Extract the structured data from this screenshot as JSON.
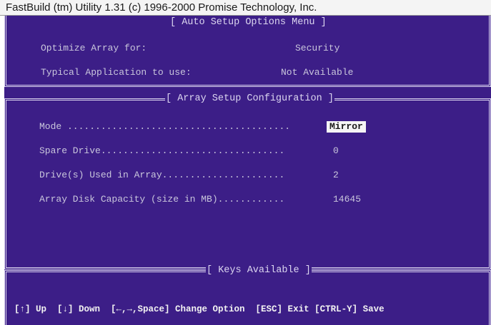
{
  "window": {
    "title": "FastBuild (tm) Utility 1.31 (c) 1996-2000 Promise Technology, Inc."
  },
  "auto_setup": {
    "title": "[ Auto Setup Options Menu ]",
    "optimize_label": "Optimize Array for:",
    "optimize_value": "Security",
    "application_label": "Typical Application to use:",
    "application_value": "Not Available"
  },
  "array_setup": {
    "title": "[ Array Setup Configuration ]",
    "mode_label": "Mode ........................................",
    "mode_value": "Mirror",
    "spare_label": "Spare Drive................................. ",
    "spare_value": "0",
    "drives_label": "Drive(s) Used in Array...................... ",
    "drives_value": "2",
    "capacity_label": "Array Disk Capacity (size in MB)............ ",
    "capacity_value": "14645"
  },
  "keys": {
    "title": "[ Keys Available ]",
    "line": "[↑] Up  [↓] Down  [←,→,Space] Change Option  [ESC] Exit [CTRL-Y] Save"
  }
}
